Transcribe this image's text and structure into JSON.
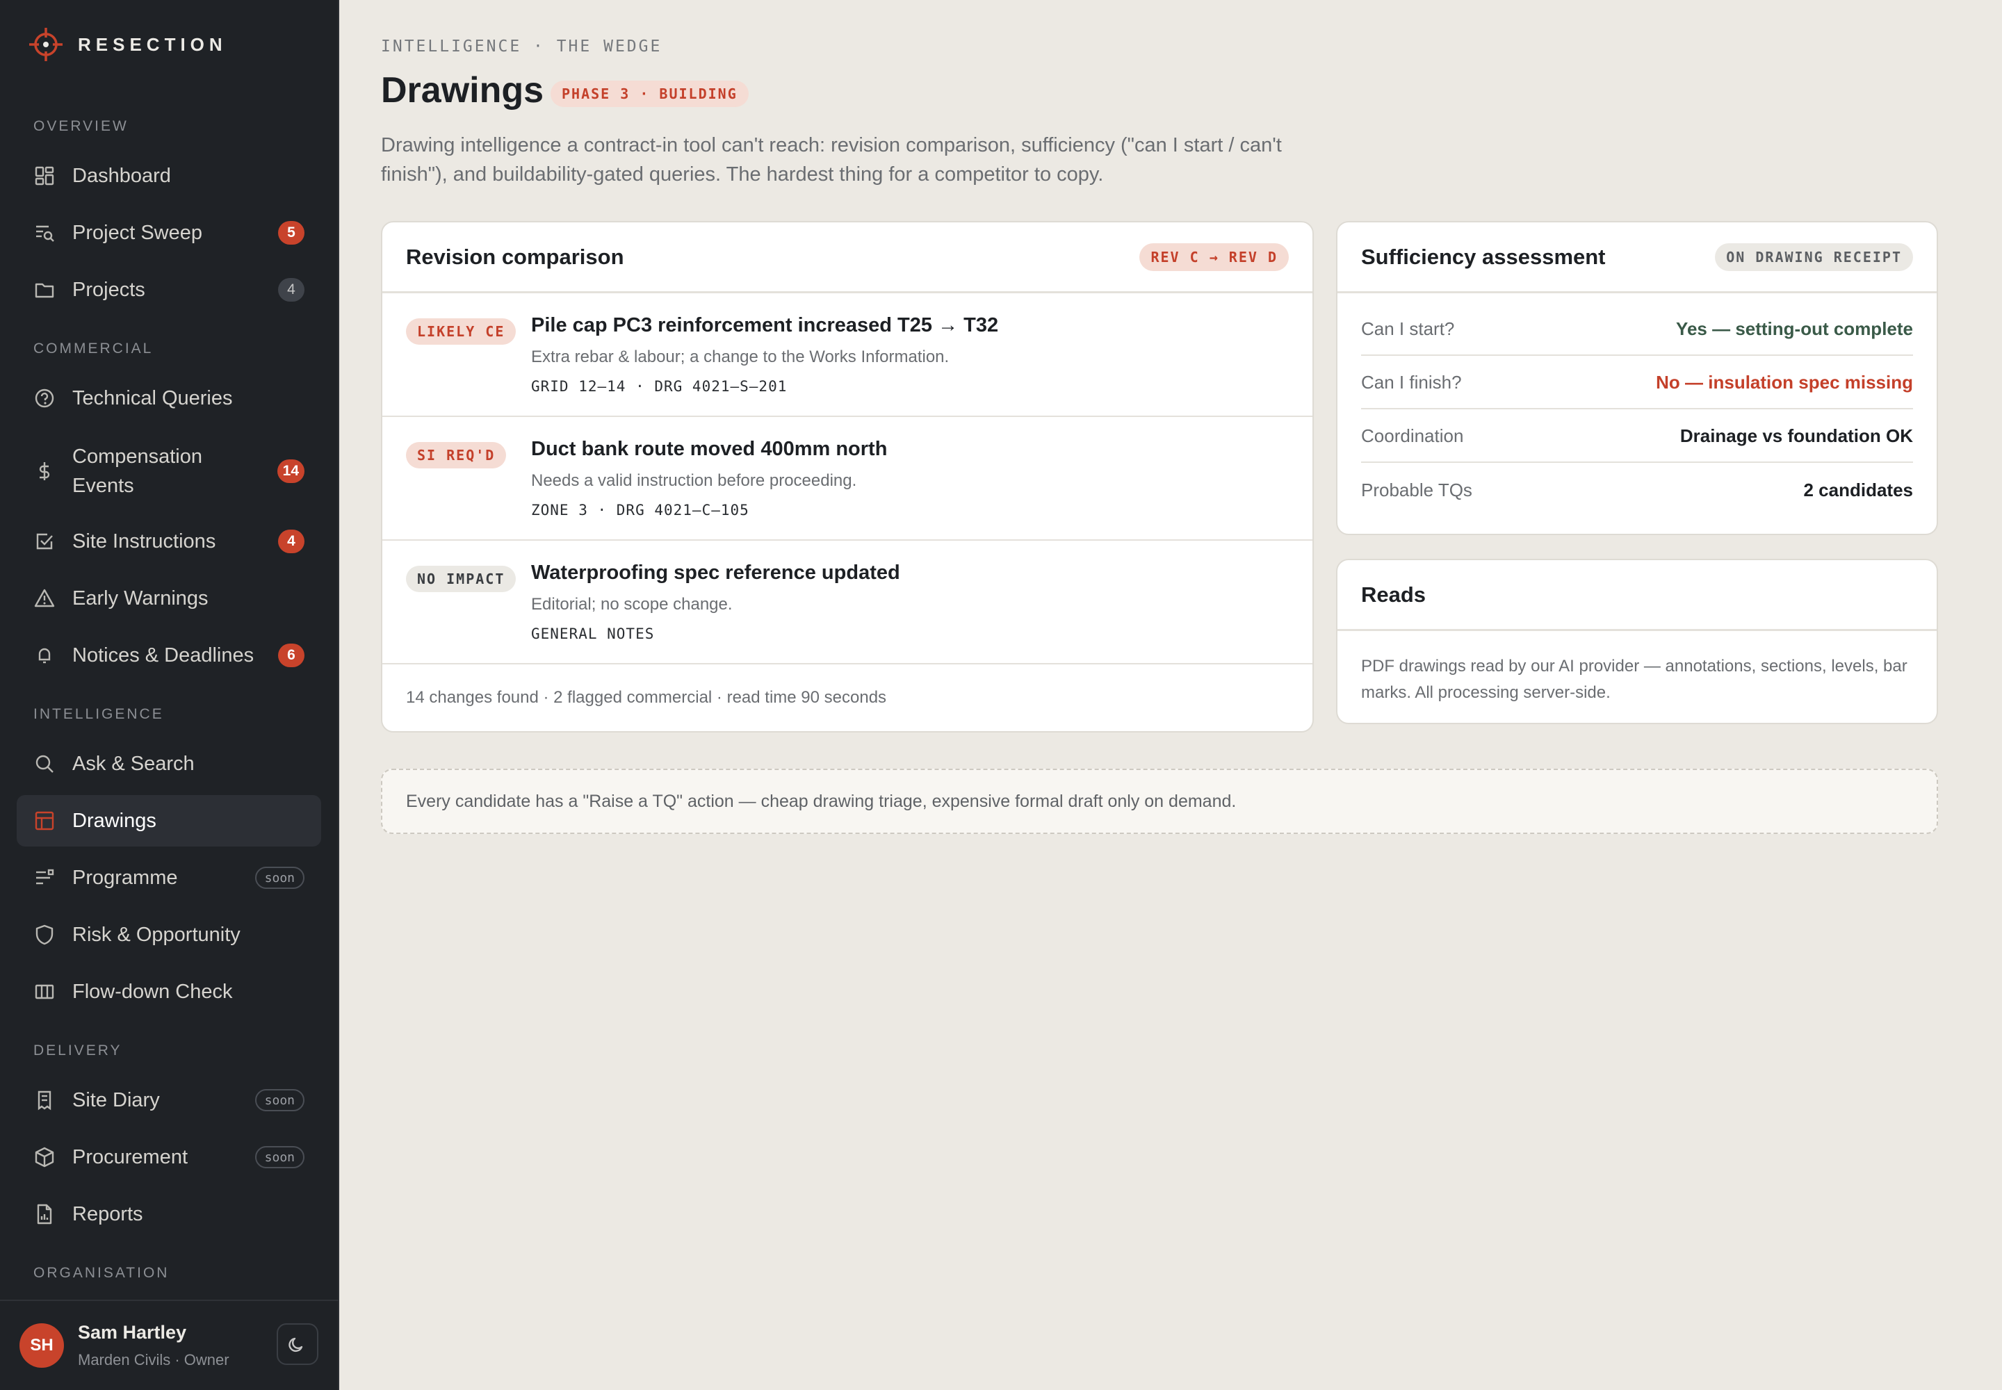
{
  "brand": {
    "name": "RESECTION"
  },
  "sidebar": {
    "sections": {
      "overview": "OVERVIEW",
      "commercial": "COMMERCIAL",
      "intelligence": "INTELLIGENCE",
      "delivery": "DELIVERY",
      "organisation": "ORGANISATION"
    },
    "items": {
      "dashboard": {
        "label": "Dashboard"
      },
      "project_sweep": {
        "label": "Project Sweep",
        "badge": "5"
      },
      "projects": {
        "label": "Projects",
        "badge": "4"
      },
      "technical_queries": {
        "label": "Technical Queries"
      },
      "compensation_events": {
        "label": "Compensation Events",
        "badge": "14"
      },
      "site_instructions": {
        "label": "Site Instructions",
        "badge": "4"
      },
      "early_warnings": {
        "label": "Early Warnings"
      },
      "notices_deadlines": {
        "label": "Notices & Deadlines",
        "badge": "6"
      },
      "ask_search": {
        "label": "Ask & Search"
      },
      "drawings": {
        "label": "Drawings"
      },
      "programme": {
        "label": "Programme",
        "tag": "soon"
      },
      "risk_opportunity": {
        "label": "Risk & Opportunity"
      },
      "flowdown_check": {
        "label": "Flow-down Check"
      },
      "site_diary": {
        "label": "Site Diary",
        "tag": "soon"
      },
      "procurement": {
        "label": "Procurement",
        "tag": "soon"
      },
      "reports": {
        "label": "Reports"
      }
    },
    "user": {
      "initials": "SH",
      "name": "Sam Hartley",
      "org": "Marden Civils · Owner"
    }
  },
  "header": {
    "breadcrumb": "INTELLIGENCE · THE WEDGE",
    "title": "Drawings",
    "phase": "PHASE 3 · BUILDING",
    "description": "Drawing intelligence a contract-in tool can't reach: revision comparison, sufficiency (\"can I start / can't finish\"), and buildability-gated queries. The hardest thing for a competitor to copy."
  },
  "revision": {
    "title": "Revision comparison",
    "pill": "REV C → REV D",
    "rows": [
      {
        "tag": "LIKELY CE",
        "title": "Pile cap PC3 reinforcement increased T25 → T32",
        "desc": "Extra rebar & labour; a change to the Works Information.",
        "ref": "GRID 12–14 · DRG 4021–S–201"
      },
      {
        "tag": "SI REQ'D",
        "title": "Duct bank route moved 400mm north",
        "desc": "Needs a valid instruction before proceeding.",
        "ref": "ZONE 3 · DRG 4021–C–105"
      },
      {
        "tag": "NO IMPACT",
        "title": "Waterproofing spec reference updated",
        "desc": "Editorial; no scope change.",
        "ref": "GENERAL NOTES"
      }
    ],
    "footer": "14 changes found · 2 flagged commercial · read time 90 seconds"
  },
  "sufficiency": {
    "title": "Sufficiency assessment",
    "pill": "ON DRAWING RECEIPT",
    "rows": [
      {
        "label": "Can I start?",
        "value": "Yes — setting-out complete",
        "status": "ok"
      },
      {
        "label": "Can I finish?",
        "value": "No — insulation spec missing",
        "status": "bad"
      },
      {
        "label": "Coordination",
        "value": "Drainage vs foundation OK",
        "status": "neutral"
      },
      {
        "label": "Probable TQs",
        "value": "2 candidates",
        "status": "neutral"
      }
    ]
  },
  "reads": {
    "title": "Reads",
    "body": "PDF drawings read by our AI provider — annotations, sections, levels, bar marks. All processing server-side."
  },
  "note": "Every candidate has a \"Raise a TQ\" action — cheap drawing triage, expensive formal draft only on demand.",
  "colors": {
    "accent": "#c8432b",
    "sidebar": "#1f2226",
    "background": "#ece9e3"
  }
}
